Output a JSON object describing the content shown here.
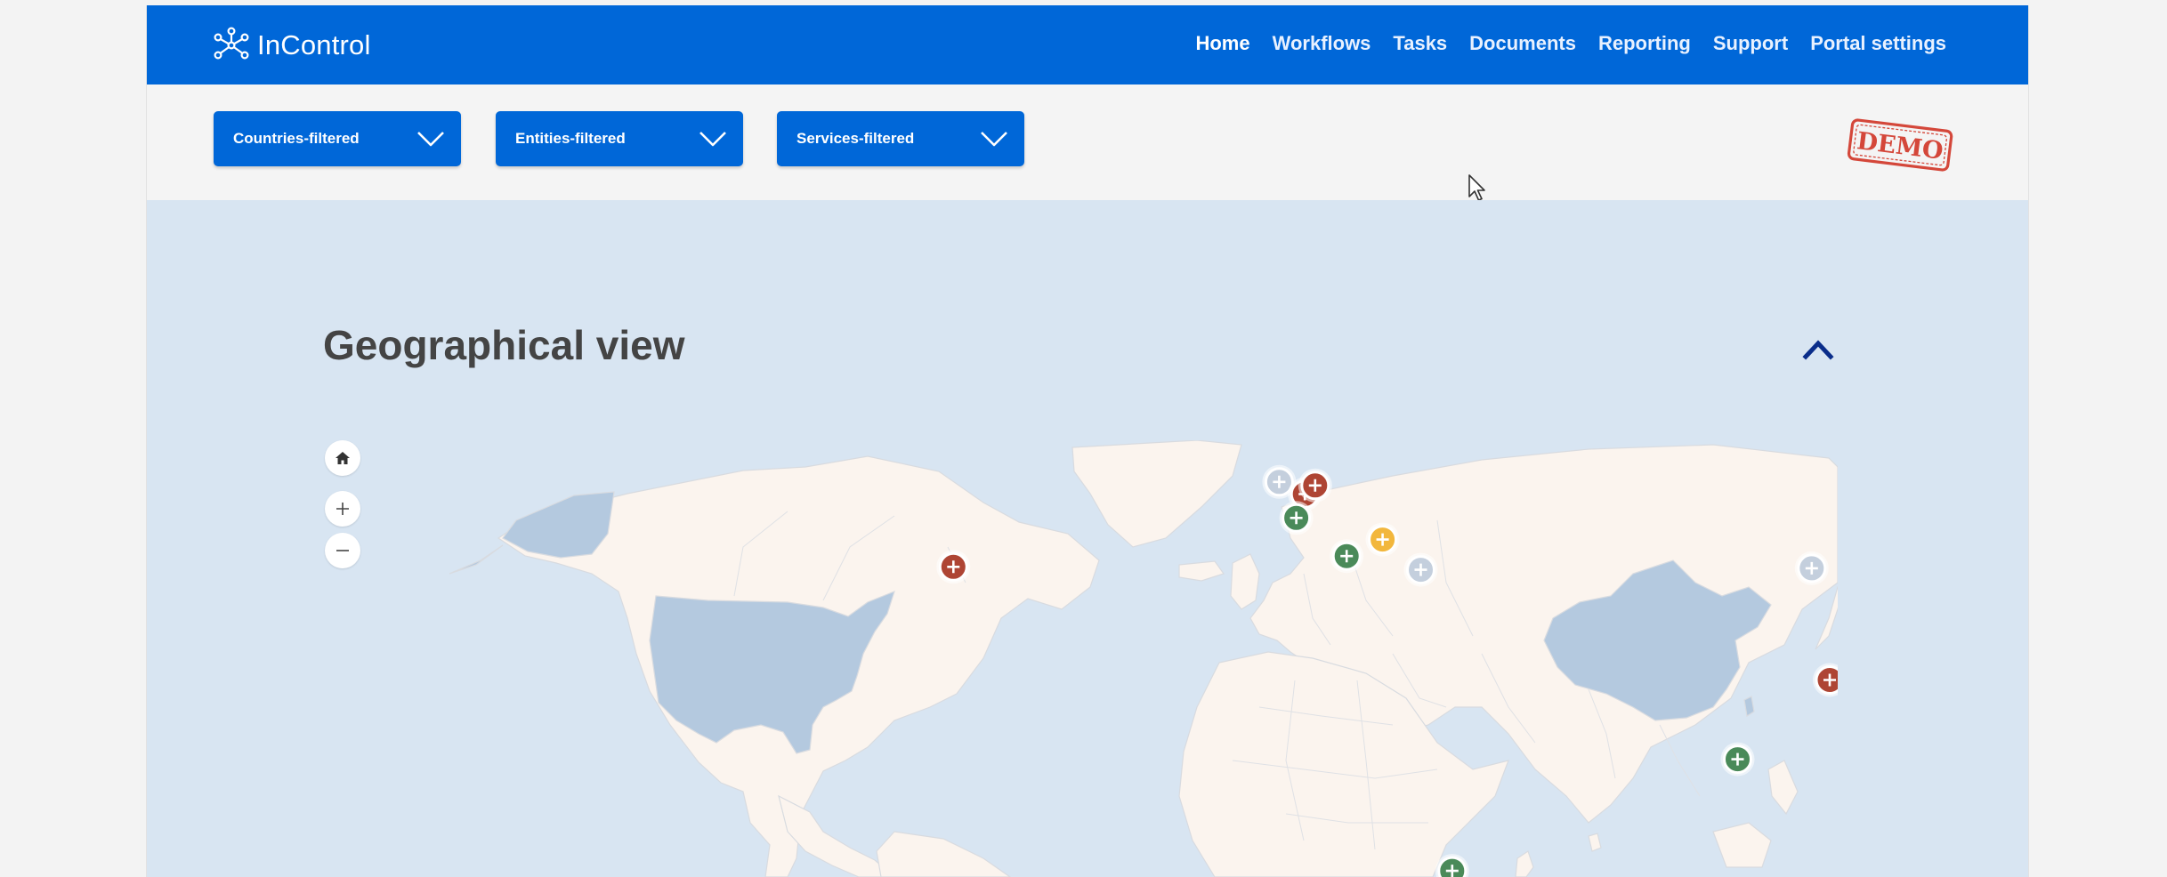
{
  "colors": {
    "primary": "#0067d8",
    "map_background": "#d8e5f2",
    "land": "#fbf4ee",
    "highlighted_country": "#b4c9df",
    "demo_stamp": "#d4473a",
    "status_red": "#ae4534",
    "status_green": "#4a8a59",
    "status_yellow": "#f2b73d",
    "status_grey": "#c4cfdd"
  },
  "header": {
    "brand": "InControl",
    "brand_icon": "network-nodes-icon",
    "nav": [
      {
        "label": "Home",
        "active": true
      },
      {
        "label": "Workflows",
        "active": false
      },
      {
        "label": "Tasks",
        "active": false
      },
      {
        "label": "Documents",
        "active": false
      },
      {
        "label": "Reporting",
        "active": false
      },
      {
        "label": "Support",
        "active": false
      },
      {
        "label": "Portal settings",
        "active": false
      }
    ]
  },
  "filters": [
    {
      "label": "Countries-filtered",
      "icon": "chevron-down-icon"
    },
    {
      "label": "Entities-filtered",
      "icon": "chevron-down-icon"
    },
    {
      "label": "Services-filtered",
      "icon": "chevron-down-icon"
    }
  ],
  "demo_stamp": "DEMO",
  "geo_section": {
    "title": "Geographical view",
    "collapse_icon": "chevron-up-icon",
    "map_controls": [
      {
        "name": "home",
        "icon": "home-icon"
      },
      {
        "name": "zoom-in",
        "icon": "plus-icon"
      },
      {
        "name": "zoom-out",
        "icon": "minus-icon"
      }
    ],
    "highlighted_countries": [
      "United States",
      "China"
    ],
    "markers": [
      {
        "location": "New York",
        "status": "red",
        "lon": -74,
        "lat": 40.7
      },
      {
        "location": "United Kingdom",
        "status": "grey",
        "lon": -1.5,
        "lat": 52.5
      },
      {
        "location": "Belgium",
        "status": "red",
        "lon": 4.2,
        "lat": 50.8
      },
      {
        "location": "Netherlands",
        "status": "red",
        "lon": 6.5,
        "lat": 52.0
      },
      {
        "location": "France",
        "status": "green",
        "lon": 2.3,
        "lat": 47.5
      },
      {
        "location": "Italy",
        "status": "green",
        "lon": 13.5,
        "lat": 42.2
      },
      {
        "location": "Balkans",
        "status": "yellow",
        "lon": 21.5,
        "lat": 44.5
      },
      {
        "location": "Turkey",
        "status": "grey",
        "lon": 30.0,
        "lat": 40.3
      },
      {
        "location": "Beijing",
        "status": "grey",
        "lon": 117.0,
        "lat": 40.5
      },
      {
        "location": "Taiwan",
        "status": "red",
        "lon": 121.0,
        "lat": 25.0
      },
      {
        "location": "Thailand",
        "status": "green",
        "lon": 100.5,
        "lat": 14.0
      },
      {
        "location": "Kenya",
        "status": "green",
        "lon": 37.0,
        "lat": -1.5
      }
    ]
  }
}
